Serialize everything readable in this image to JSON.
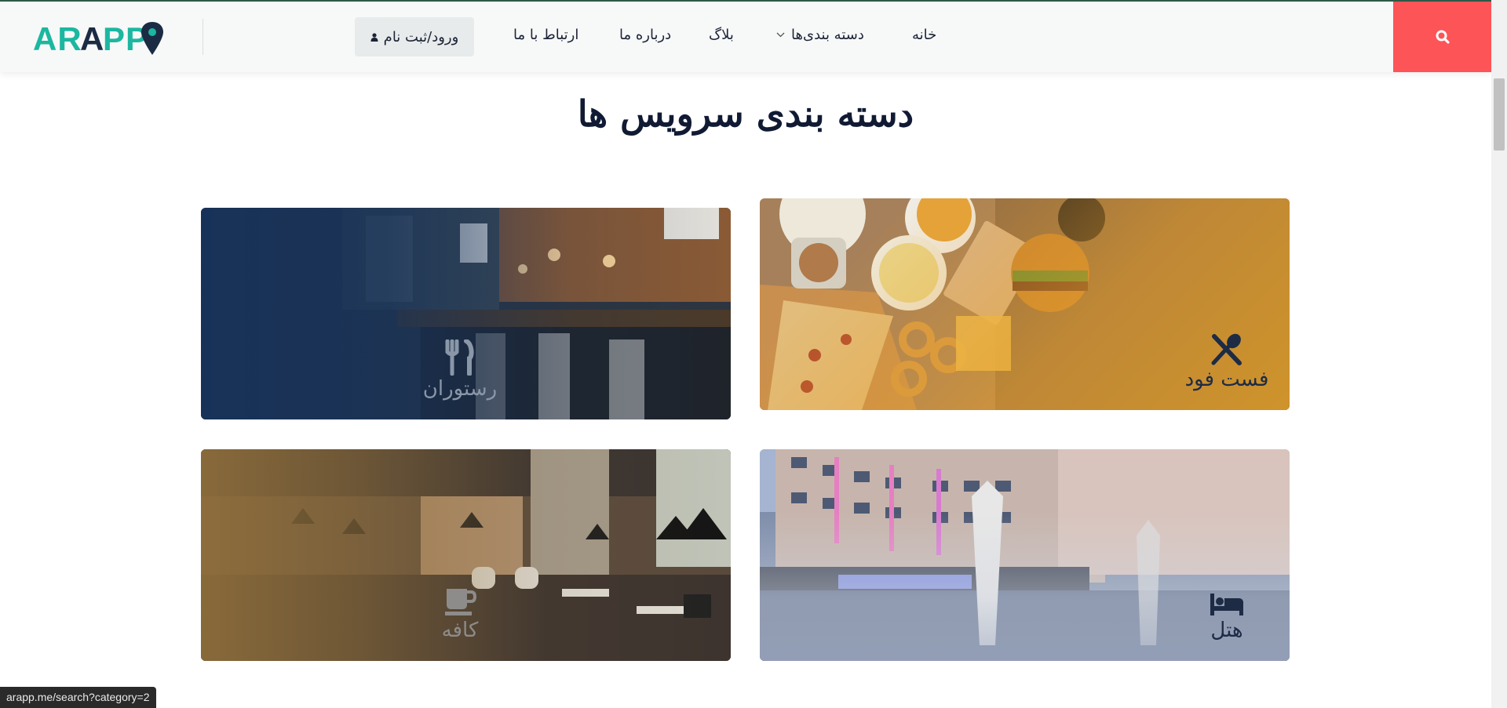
{
  "colors": {
    "accent": "#fc5457",
    "brand_teal": "#1cb7a0",
    "brand_navy": "#1b2b44",
    "header_bg": "#f7f8f8"
  },
  "header": {
    "logo_text": "ARAPP",
    "search_icon": "search-icon",
    "nav": {
      "home": "خانه",
      "categories": "دسته بندی‌ها",
      "blog": "بلاگ",
      "about": "درباره ما",
      "contact": "ارتباط با ما"
    },
    "login_label": "ورود/ثبت نام",
    "login_icon": "user-icon"
  },
  "main": {
    "title": "دسته بندی سرویس ها",
    "categories": [
      {
        "name": "فست فود",
        "icon": "utensils-crossed-icon"
      },
      {
        "name": "رستوران",
        "icon": "fork-knife-icon"
      },
      {
        "name": "هتل",
        "icon": "bed-icon"
      },
      {
        "name": "کافه",
        "icon": "coffee-cup-icon"
      }
    ]
  },
  "status_bar": {
    "url": "arapp.me/search?category=2"
  }
}
